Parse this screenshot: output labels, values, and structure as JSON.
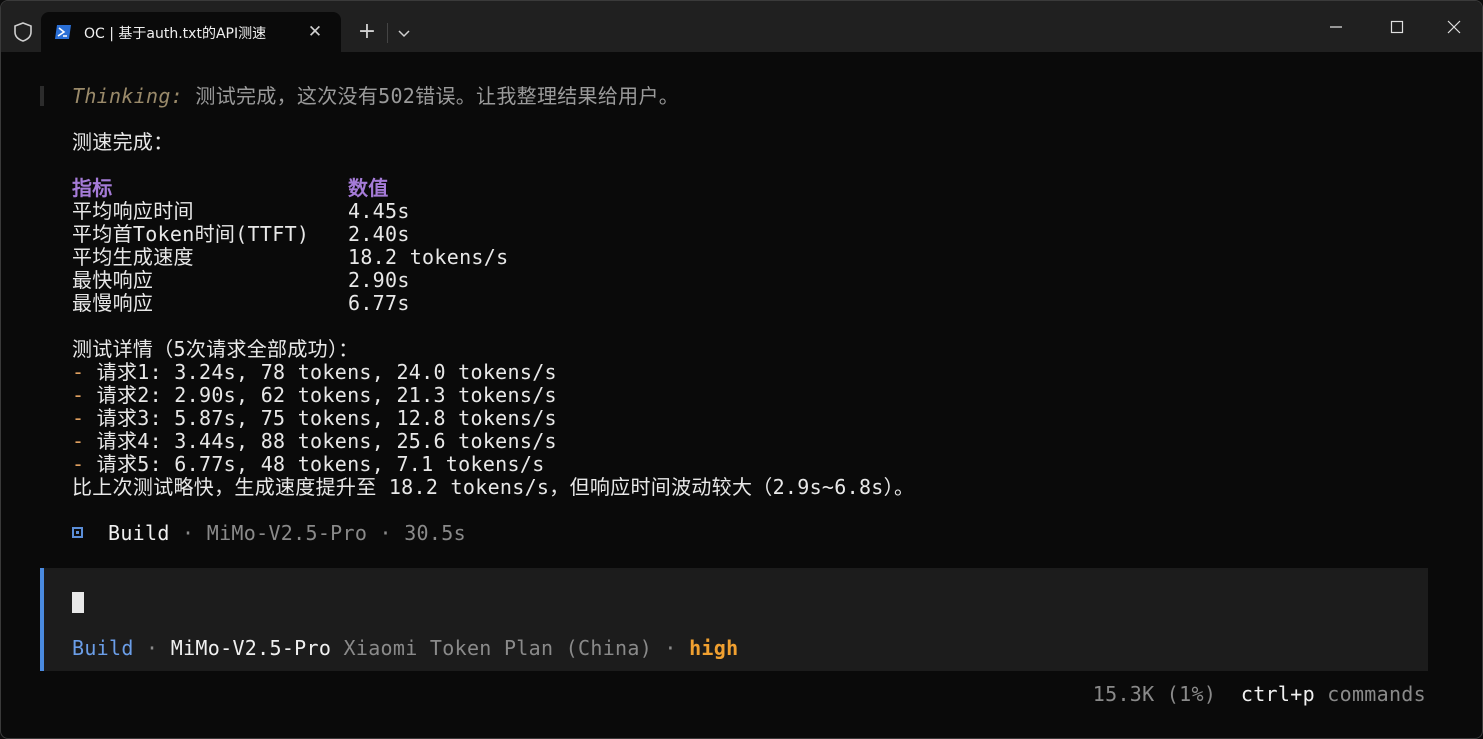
{
  "window": {
    "tab_title": "OC | 基于auth.txt的API测速"
  },
  "thinking": {
    "label": "Thinking:",
    "text": " 测试完成，这次没有502错误。让我整理结果给用户。"
  },
  "summary_heading": "测速完成：",
  "table": {
    "headers": [
      "指标",
      "数值"
    ],
    "rows": [
      [
        "平均响应时间",
        "4.45s"
      ],
      [
        "平均首Token时间(TTFT)",
        "2.40s"
      ],
      [
        "平均生成速度",
        "18.2 tokens/s"
      ],
      [
        "最快响应",
        "2.90s"
      ],
      [
        "最慢响应",
        "6.77s"
      ]
    ]
  },
  "details": {
    "heading": "测试详情（5次请求全部成功）：",
    "bullet": "-",
    "items": [
      " 请求1: 3.24s, 78 tokens, 24.0 tokens/s",
      " 请求2: 2.90s, 62 tokens, 21.3 tokens/s",
      " 请求3: 5.87s, 75 tokens, 12.8 tokens/s",
      " 请求4: 3.44s, 88 tokens, 25.6 tokens/s",
      " 请求5: 6.77s, 48 tokens, 7.1 tokens/s"
    ],
    "conclusion": "比上次测试略快，生成速度提升至 18.2 tokens/s，但响应时间波动较大（2.9s~6.8s）。"
  },
  "build_info": {
    "mode": "Build",
    "sep1": " · ",
    "model": "MiMo-V2.5-Pro",
    "sep2": " · ",
    "duration": "30.5s"
  },
  "input": {
    "mode": "Build",
    "sep1": " · ",
    "model": "MiMo-V2.5-Pro",
    "provider": " Xiaomi Token Plan (China)",
    "sep2": " · ",
    "effort": "high"
  },
  "footer": {
    "tokens": "15.3K (1%)",
    "shortcut": "ctrl+p",
    "shortcut_label": " commands"
  },
  "colors": {
    "accent_blue": "#4a8ae0",
    "header_purple": "#a57bd7",
    "effort_orange": "#f0a030",
    "bullet_orange": "#e0a060"
  }
}
